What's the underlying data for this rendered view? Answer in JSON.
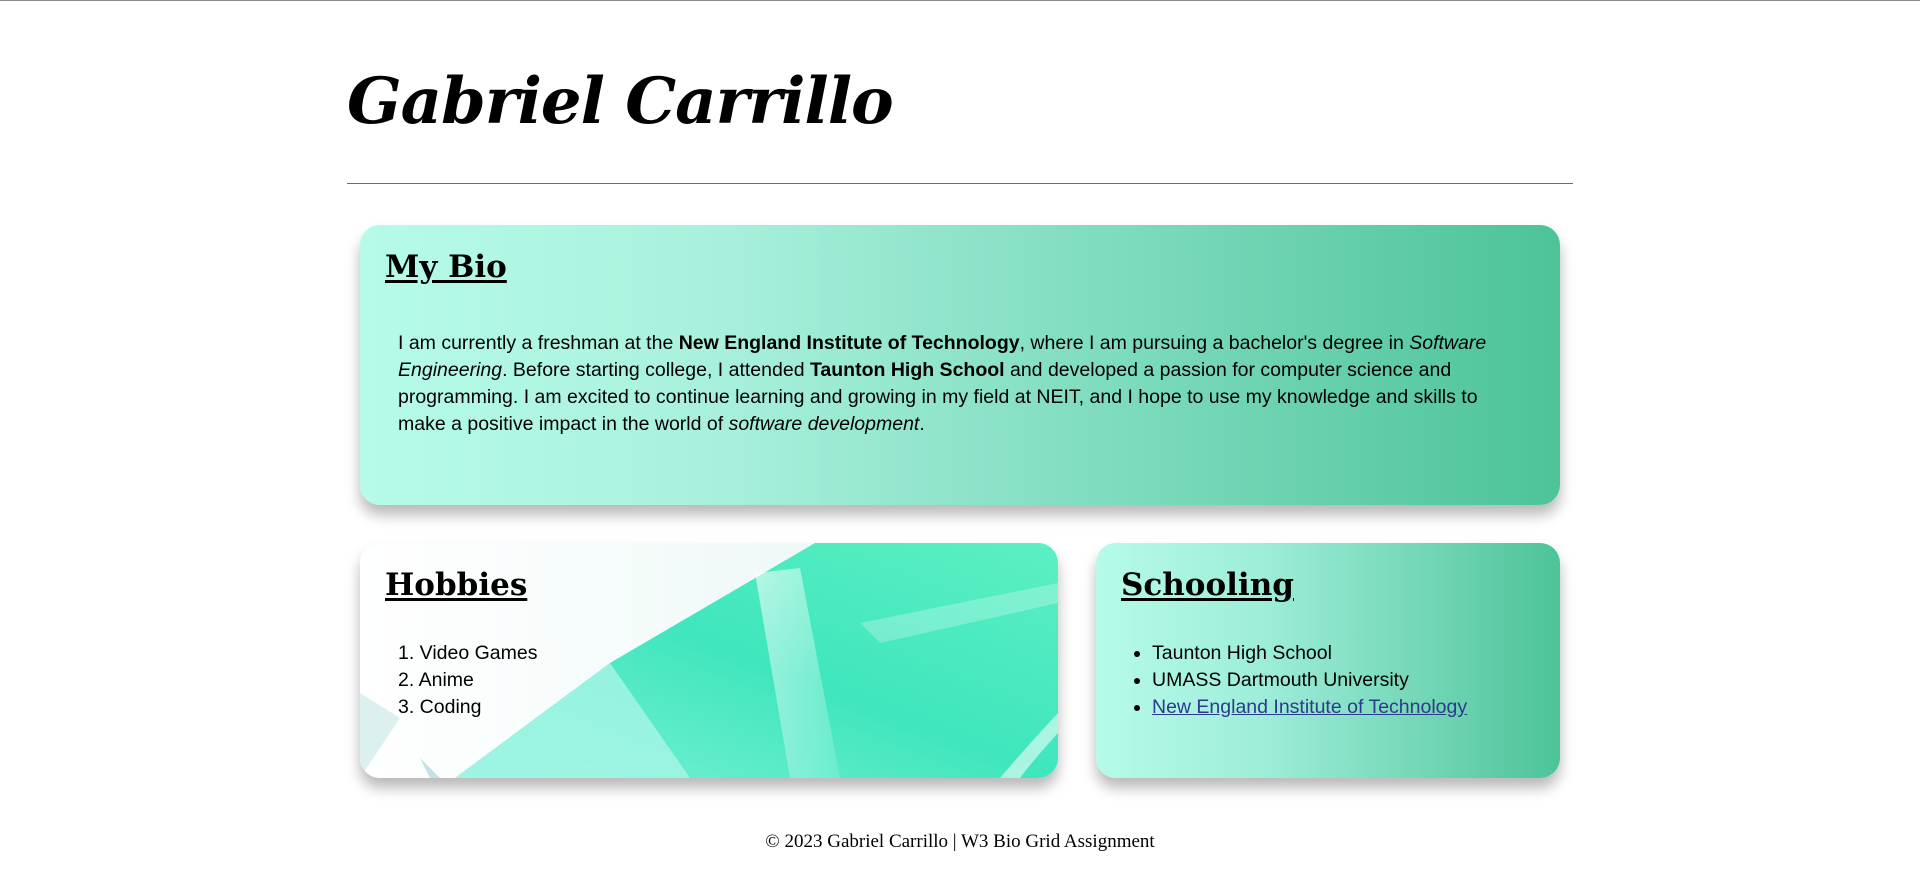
{
  "header": {
    "title": "Gabriel Carrillo"
  },
  "bio": {
    "heading": "My Bio",
    "p1": "I am currently a freshman at the ",
    "b1": "New England Institute of Technology",
    "p2": ", where I am pursuing a bachelor's degree in ",
    "i1": "Software Engineering",
    "p3": ". Before starting college, I attended ",
    "b2": "Taunton High School",
    "p4": " and developed a passion for computer science and programming. I am excited to continue learning and growing in my field at NEIT, and I hope to use my knowledge and skills to make a positive impact in the world of ",
    "i2": "software development",
    "p5": "."
  },
  "hobbies": {
    "heading": "Hobbies",
    "items": [
      "1. Video Games",
      "2. Anime",
      "3. Coding"
    ]
  },
  "schooling": {
    "heading": "Schooling",
    "items": [
      "Taunton High School",
      "UMASS Dartmouth University"
    ],
    "link_label": "New England Institute of Technology"
  },
  "footer": {
    "text": "© 2023 Gabriel Carrillo | W3 Bio Grid Assignment"
  },
  "colors": {
    "gradient_light": "#b6fbe9",
    "gradient_dark": "#4dc398",
    "link": "#2d3a8c"
  }
}
